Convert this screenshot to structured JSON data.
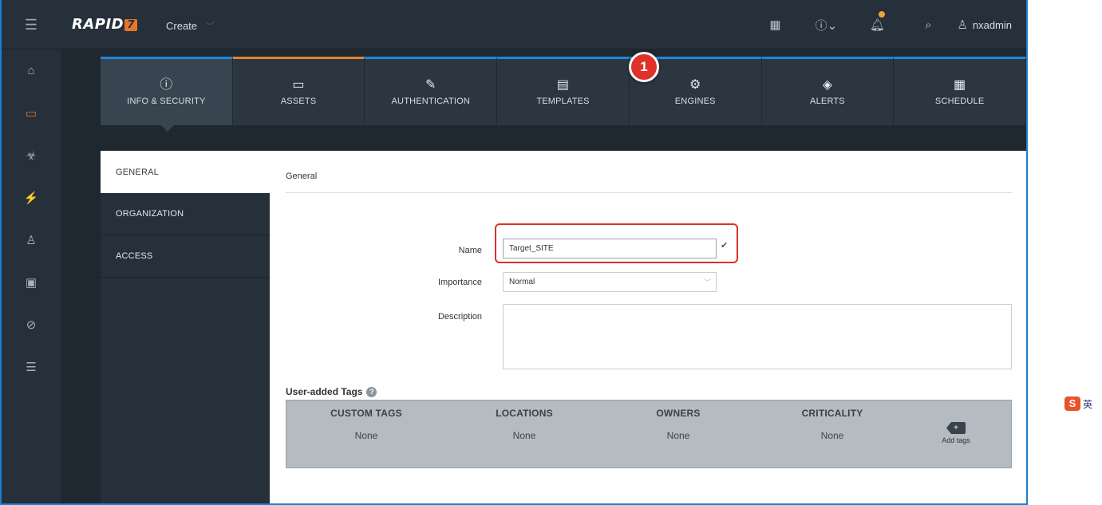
{
  "topbar": {
    "menu_icon": "hamburger-icon",
    "logo_text": "RAPID",
    "logo_mark": "7",
    "create_label": "Create",
    "icons": [
      "calendar-icon",
      "help-icon",
      "bell-icon",
      "search-icon"
    ],
    "user_name": "nxadmin"
  },
  "rail": {
    "items": [
      "home-icon",
      "assets-icon",
      "vulnerabilities-icon",
      "policies-icon",
      "reports-icon",
      "dashboard-icon",
      "integrations-icon",
      "list-icon"
    ],
    "active_index": 1
  },
  "tabs": [
    {
      "label": "INFO & SECURITY",
      "icon": "ⓘ"
    },
    {
      "label": "ASSETS",
      "icon": "▭"
    },
    {
      "label": "AUTHENTICATION",
      "icon": "✎"
    },
    {
      "label": "TEMPLATES",
      "icon": "▤"
    },
    {
      "label": "ENGINES",
      "icon": "⚙"
    },
    {
      "label": "ALERTS",
      "icon": "◈"
    },
    {
      "label": "SCHEDULE",
      "icon": "▦"
    }
  ],
  "subnav": [
    "GENERAL",
    "ORGANIZATION",
    "ACCESS"
  ],
  "form": {
    "section_title": "General",
    "name_label": "Name",
    "name_value": "Target_SITE",
    "importance_label": "Importance",
    "importance_value": "Normal",
    "description_label": "Description",
    "description_value": ""
  },
  "step_badge": "1",
  "tags": {
    "title": "User-added Tags",
    "columns": [
      {
        "header": "CUSTOM TAGS",
        "value": "None"
      },
      {
        "header": "LOCATIONS",
        "value": "None"
      },
      {
        "header": "OWNERS",
        "value": "None"
      },
      {
        "header": "CRITICALITY",
        "value": "None"
      }
    ],
    "add_label": "Add tags"
  },
  "ime": {
    "badge": "S",
    "text": "英"
  }
}
